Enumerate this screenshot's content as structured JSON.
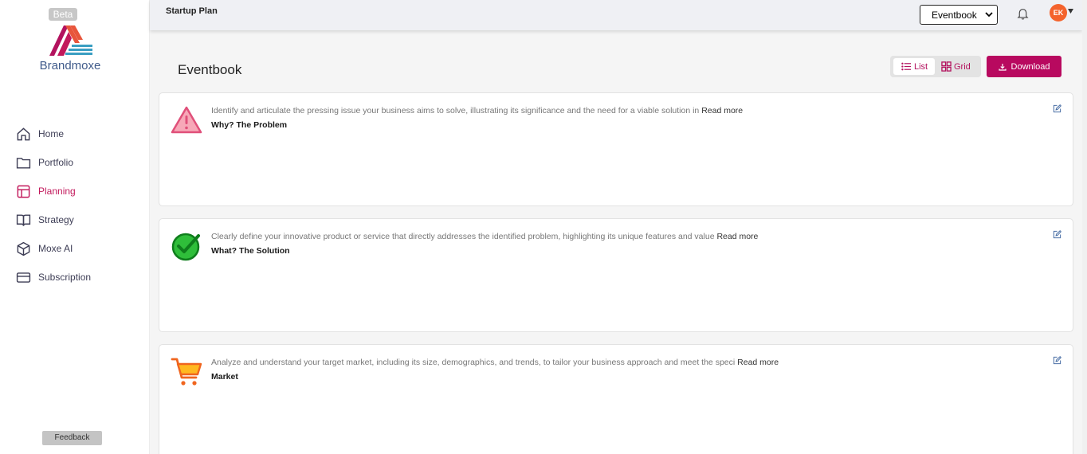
{
  "sidebar": {
    "badge": "Beta",
    "brand": "Brandmoxe",
    "items": [
      {
        "label": "Home",
        "icon": "home-icon"
      },
      {
        "label": "Portfolio",
        "icon": "folder-icon"
      },
      {
        "label": "Planning",
        "icon": "layout-icon"
      },
      {
        "label": "Strategy",
        "icon": "book-icon"
      },
      {
        "label": "Moxe AI",
        "icon": "cube-icon"
      },
      {
        "label": "Subscription",
        "icon": "card-icon"
      }
    ],
    "active": "Planning",
    "feedback": "Feedback"
  },
  "topbar": {
    "title": "Startup Plan",
    "select_value": "Eventbook",
    "avatar_initials": "EK"
  },
  "main": {
    "title": "Eventbook",
    "view_list": "List",
    "view_grid": "Grid",
    "download": "Download",
    "cards": [
      {
        "description": "Identify and articulate the pressing issue your business aims to solve, illustrating its significance and the need for a viable solution in",
        "read_more": "Read more",
        "title": "Why? The Problem",
        "icon": "warning-icon"
      },
      {
        "description": "Clearly define your innovative product or service that directly addresses the identified problem, highlighting its unique features and value",
        "read_more": "Read more",
        "title": "What? The Solution",
        "icon": "check-circle-icon"
      },
      {
        "description": "Analyze and understand your target market, including its size, demographics, and trends, to tailor your business approach and meet the speci",
        "read_more": "Read more",
        "title": "Market",
        "icon": "cart-icon"
      }
    ]
  },
  "colors": {
    "accent": "#b8095f",
    "active_nav": "#c2185b",
    "avatar": "#f4632d",
    "brand_text": "#3f5a8a"
  }
}
